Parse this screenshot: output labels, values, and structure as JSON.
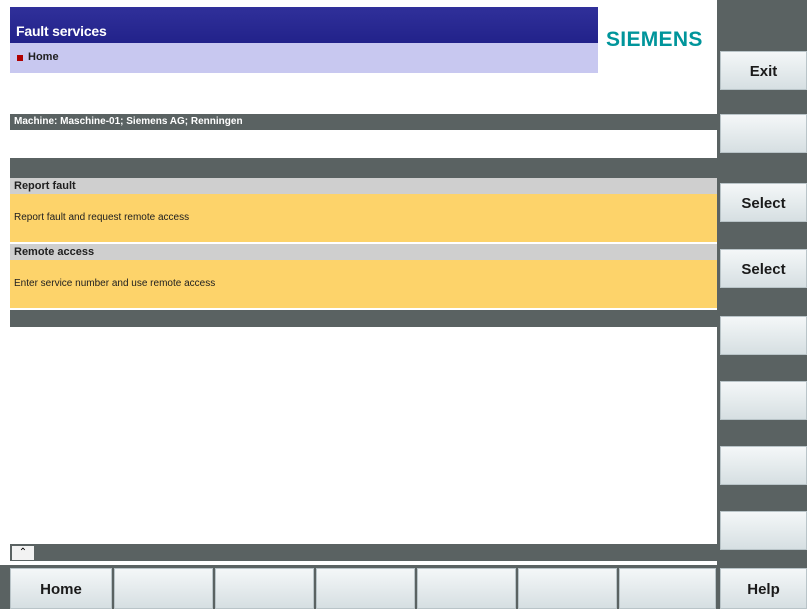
{
  "header": {
    "title": "Fault services",
    "breadcrumb": "Home",
    "logo": "SIEMENS"
  },
  "machine": {
    "info": "Machine: Maschine-01; Siemens AG; Renningen"
  },
  "sections": [
    {
      "heading": "Report fault",
      "description": "Report fault and request remote access"
    },
    {
      "heading": "Remote access",
      "description": "Enter service number and use remote access"
    }
  ],
  "scroll": {
    "up_icon": "chevron-up-icon",
    "glyph": "⌃"
  },
  "softkeys_right": [
    "Exit",
    "",
    "Select",
    "Select",
    "",
    "",
    "",
    ""
  ],
  "softkeys_bottom": [
    "Home",
    "",
    "",
    "",
    "",
    "",
    "",
    "Help"
  ],
  "colors": {
    "title_bar": "#22228a",
    "breadcrumb_bg": "#c8c8f0",
    "logo": "#00959b",
    "highlight": "#fdd36a",
    "frame": "#5a6262"
  }
}
